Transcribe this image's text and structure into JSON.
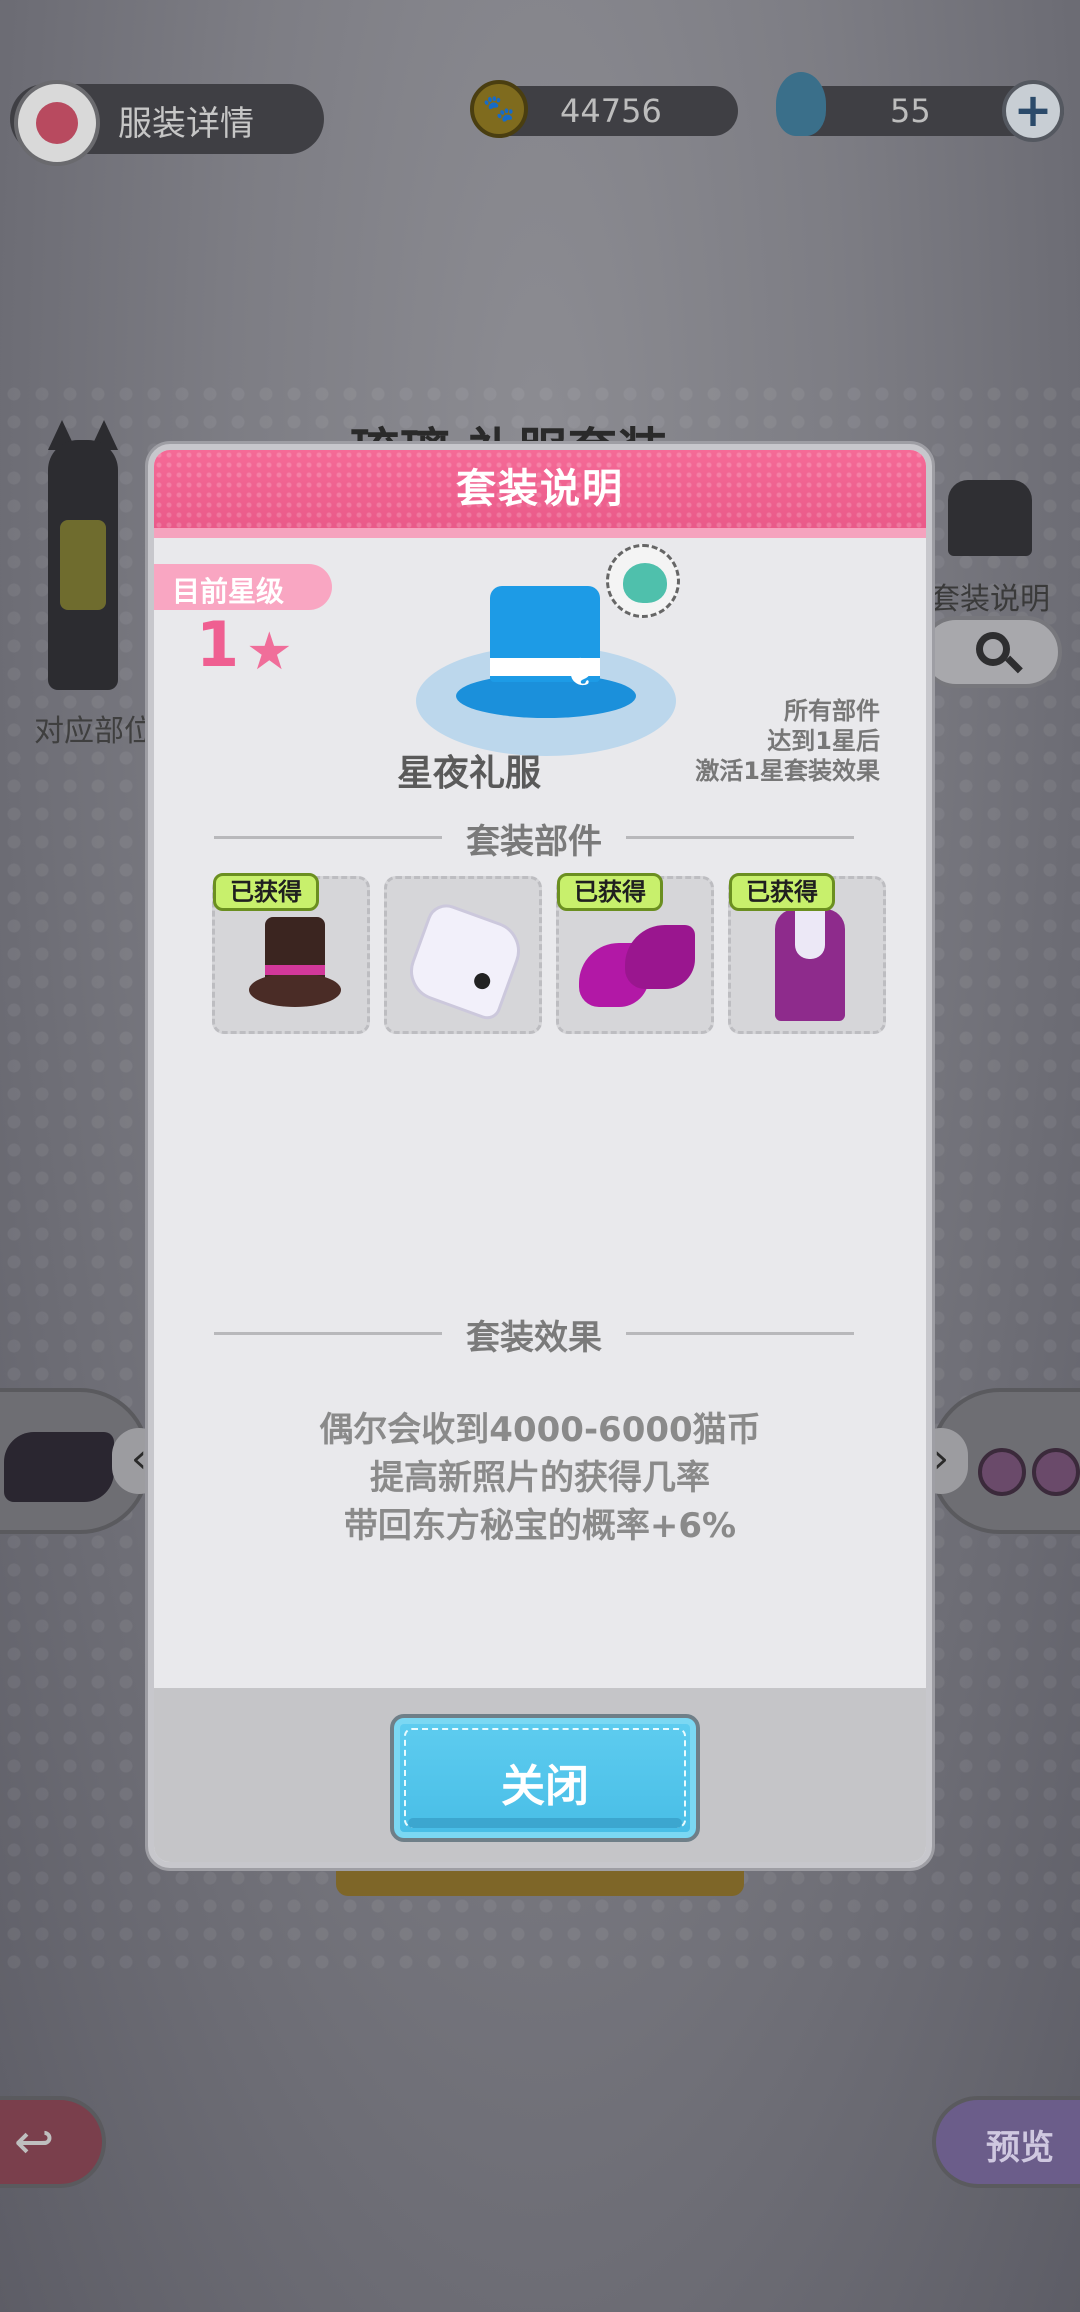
{
  "header": {
    "title": "服装详情",
    "coins": "44756",
    "gems": "55"
  },
  "background": {
    "title_partial": "琉璃 礼服套装",
    "left_label": "对应部位",
    "right_label": "套装说明",
    "bottom_right_label": "预览"
  },
  "modal": {
    "title": "套装说明",
    "star_tag": "目前星级",
    "star_level": "1",
    "suit_name": "星夜礼服",
    "hint_lines": [
      "所有部件",
      "达到1星后",
      "激活1星套装效果"
    ],
    "parts_title": "套装部件",
    "parts": [
      {
        "name": "hat",
        "badge": "已获得"
      },
      {
        "name": "cuff",
        "badge": ""
      },
      {
        "name": "shoes",
        "badge": "已获得"
      },
      {
        "name": "vest",
        "badge": "已获得"
      }
    ],
    "effects_title": "套装效果",
    "effects": [
      "偶尔会收到4000-6000猫币",
      "提高新照片的获得几率",
      "带回东方秘宝的概率+6%"
    ],
    "close_label": "关闭"
  },
  "colors": {
    "header_pink": "#f06a97",
    "close_blue": "#5fcdf0",
    "badge_green": "#c8f06c"
  }
}
